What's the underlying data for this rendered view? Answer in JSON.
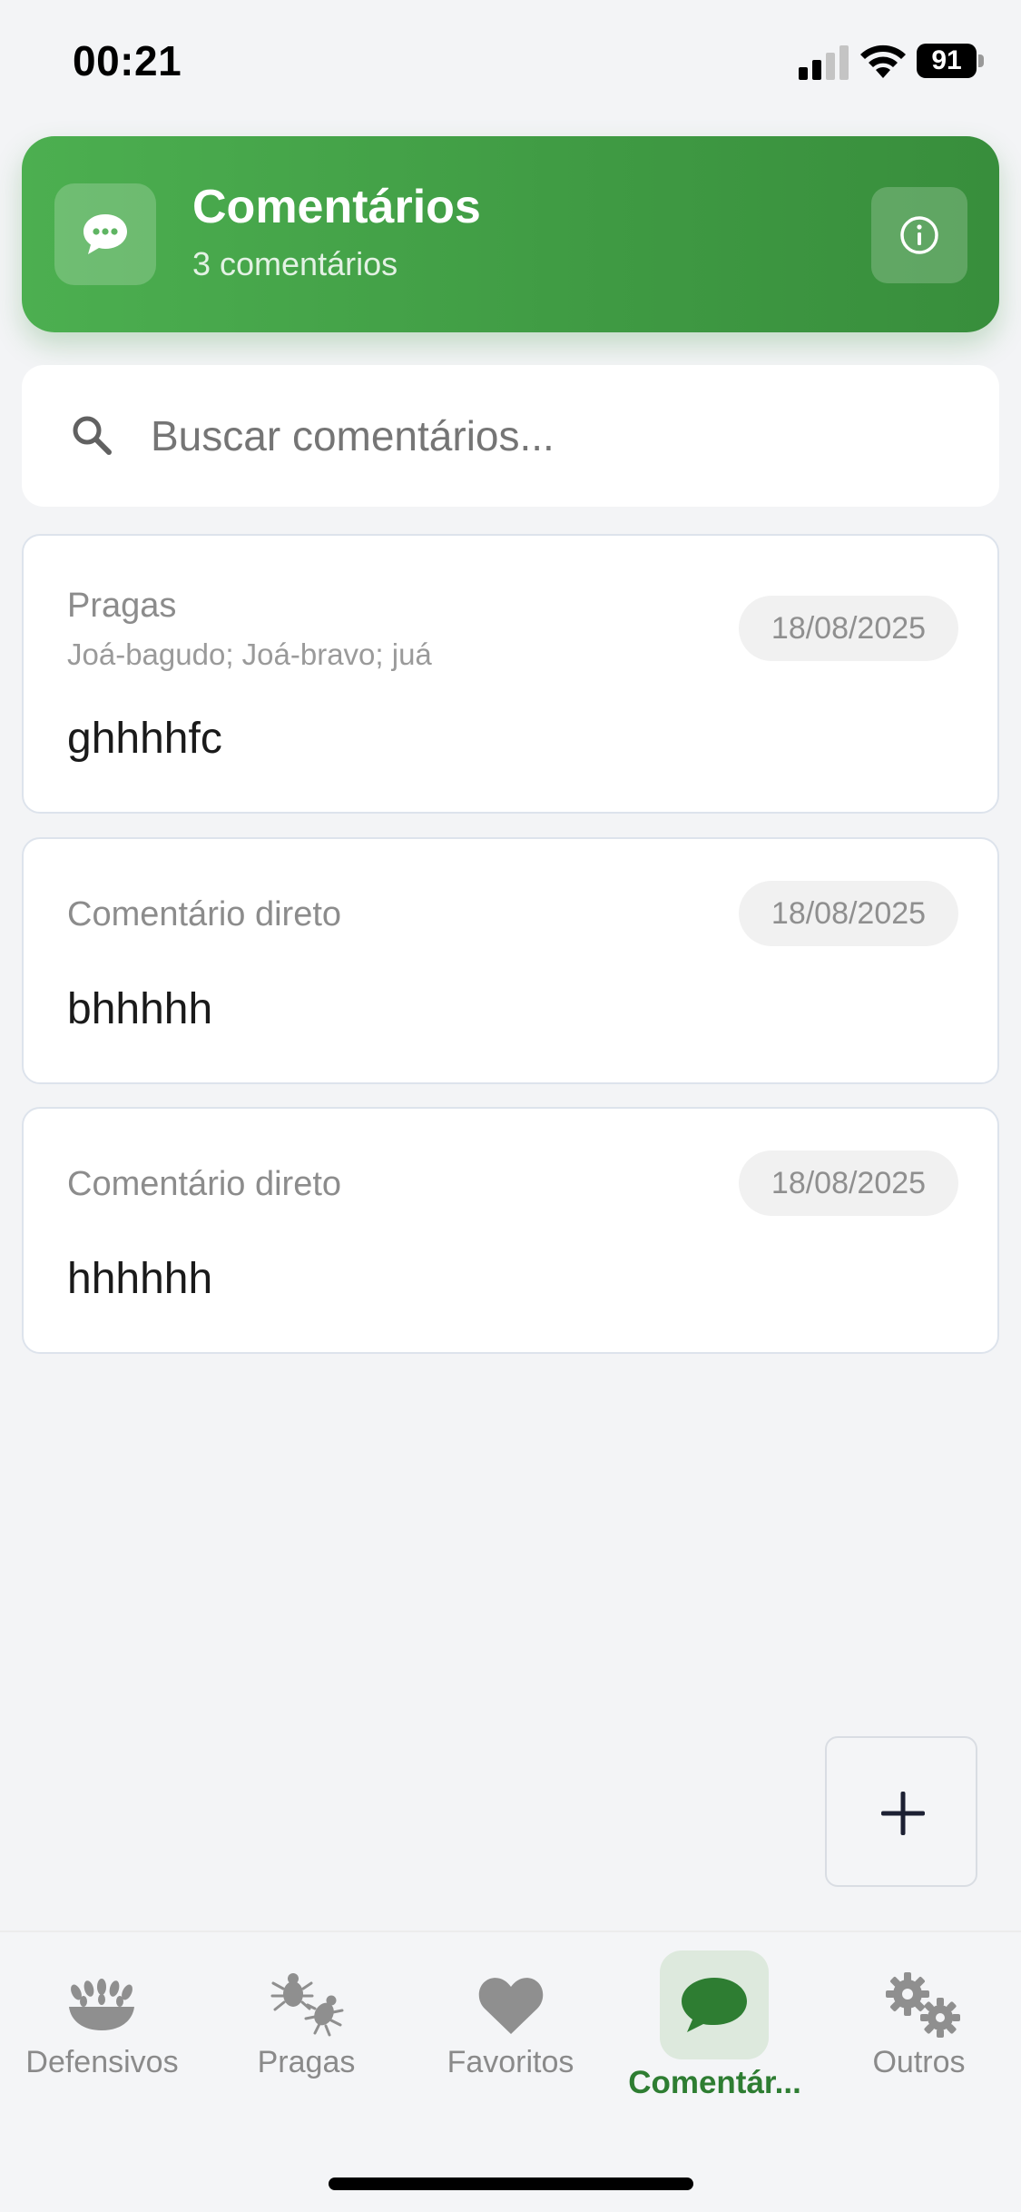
{
  "status_bar": {
    "time": "00:21",
    "battery": "91",
    "icons": [
      "signal-icon",
      "wifi-icon",
      "battery-icon"
    ]
  },
  "header": {
    "title": "Comentários",
    "subtitle": "3 comentários",
    "icon": "chat-bubble-icon",
    "info_icon": "info-icon"
  },
  "search": {
    "placeholder": "Buscar comentários...",
    "value": "",
    "icon": "search-icon"
  },
  "comments": [
    {
      "category": "Pragas",
      "subtitle": "Joá-bagudo; Joá-bravo; juá",
      "date": "18/08/2025",
      "text": "ghhhhfc"
    },
    {
      "category": "Comentário direto",
      "date": "18/08/2025",
      "text": "bhhhhh"
    },
    {
      "category": "Comentário direto",
      "date": "18/08/2025",
      "text": "hhhhhh"
    }
  ],
  "fab": {
    "icon": "plus-icon"
  },
  "nav": {
    "items": [
      {
        "label": "Defensivos",
        "icon": "grain-bowl-icon",
        "active": false
      },
      {
        "label": "Pragas",
        "icon": "bugs-icon",
        "active": false
      },
      {
        "label": "Favoritos",
        "icon": "heart-icon",
        "active": false
      },
      {
        "label": "Comentár...",
        "icon": "chat-bubble-icon",
        "active": true
      },
      {
        "label": "Outros",
        "icon": "gears-icon",
        "active": false
      }
    ]
  },
  "colors": {
    "primary": "#4caf50",
    "primary_dark": "#388e3c",
    "active_nav": "#2e7d32",
    "background": "#f3f4f6"
  }
}
